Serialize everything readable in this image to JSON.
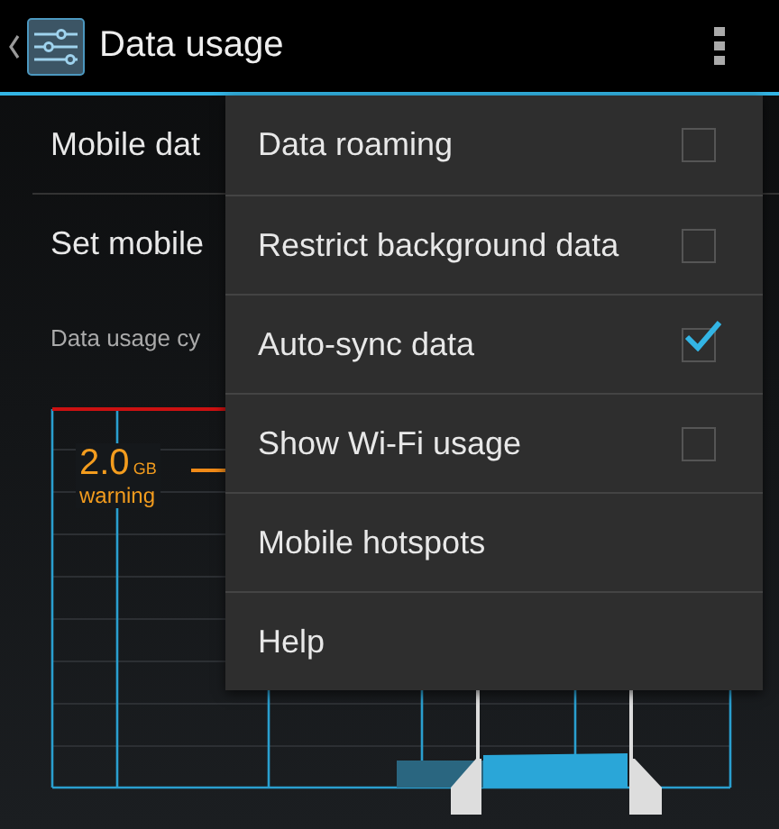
{
  "action_bar": {
    "title": "Data usage"
  },
  "settings": [
    {
      "label": "Mobile dat"
    },
    {
      "label": "Set mobile"
    }
  ],
  "cycle_label": "Data usage cy",
  "chart": {
    "warning_value": "2.0",
    "warning_unit": "GB",
    "warning_label": "warning"
  },
  "menu": [
    {
      "label": "Data roaming",
      "kind": "checkbox",
      "checked": false
    },
    {
      "label": "Restrict background data",
      "kind": "checkbox",
      "checked": false
    },
    {
      "label": "Auto-sync data",
      "kind": "checkbox",
      "checked": true
    },
    {
      "label": "Show Wi-Fi usage",
      "kind": "checkbox",
      "checked": false
    },
    {
      "label": "Mobile hotspots",
      "kind": "action"
    },
    {
      "label": "Help",
      "kind": "action"
    }
  ]
}
